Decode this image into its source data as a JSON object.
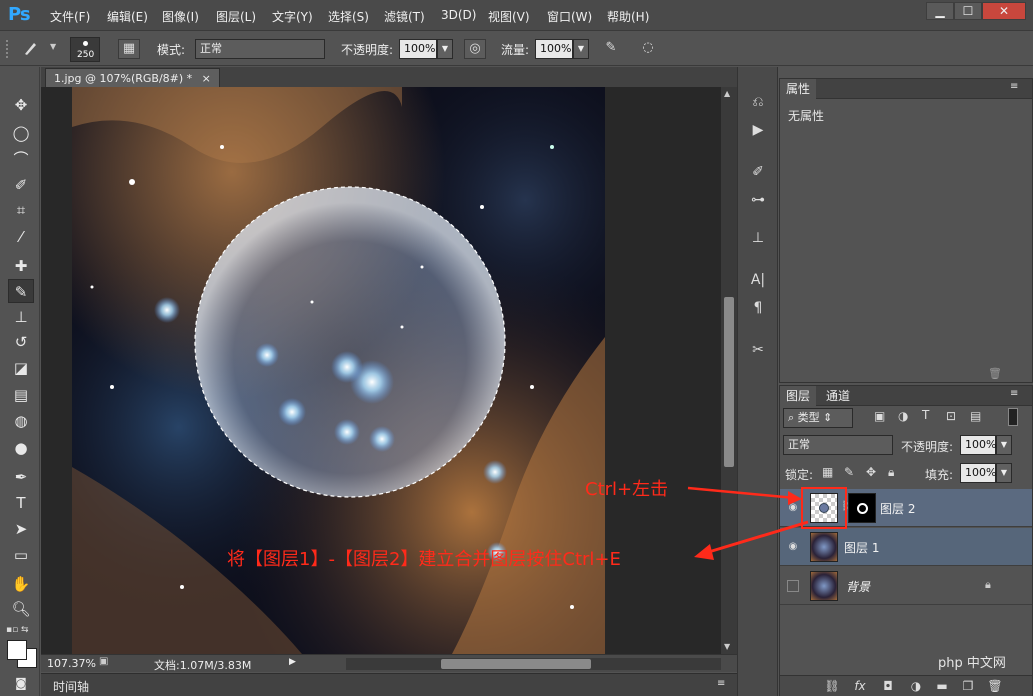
{
  "app": {
    "logo": "Ps"
  },
  "menu": [
    "文件(F)",
    "编辑(E)",
    "图像(I)",
    "图层(L)",
    "文字(Y)",
    "选择(S)",
    "滤镜(T)",
    "3D(D)",
    "视图(V)",
    "窗口(W)",
    "帮助(H)"
  ],
  "window_controls": {
    "minimize": "▁",
    "maximize": "☐",
    "close": "✕"
  },
  "options": {
    "brush_size": "250",
    "mode_label": "模式:",
    "mode_value": "正常",
    "opacity_label": "不透明度:",
    "opacity_value": "100%",
    "flow_label": "流量:",
    "flow_value": "100%"
  },
  "document": {
    "tab_title": "1.jpg @ 107%(RGB/8#) *",
    "tab_close": "×",
    "zoom": "107.37%",
    "doc_info": "文档:1.07M/3.83M"
  },
  "timeline": {
    "label": "时间轴"
  },
  "properties": {
    "tab": "属性",
    "content": "无属性"
  },
  "layers_panel": {
    "tabs": [
      "图层",
      "通道"
    ],
    "filter_kind": "类型",
    "blend_mode": "正常",
    "opacity_label": "不透明度:",
    "opacity_value": "100%",
    "lock_label": "锁定:",
    "fill_label": "填充:",
    "fill_value": "100%",
    "layers": [
      {
        "name": "图层 2",
        "visible": true,
        "selected": true
      },
      {
        "name": "图层 1",
        "visible": true,
        "selected": true
      },
      {
        "name": "背景",
        "visible": false,
        "selected": false,
        "locked": true
      }
    ]
  },
  "annotations": {
    "ctrl_click": "Ctrl+左击",
    "merge_instruction": "将【图层1】-【图层2】建立合并图层按住Ctrl+E"
  },
  "watermark": "php 中文网",
  "colors": {
    "annotation": "#ff2a1a",
    "selected_layer": "#5b6a80",
    "ps_blue": "#31a8ff"
  }
}
